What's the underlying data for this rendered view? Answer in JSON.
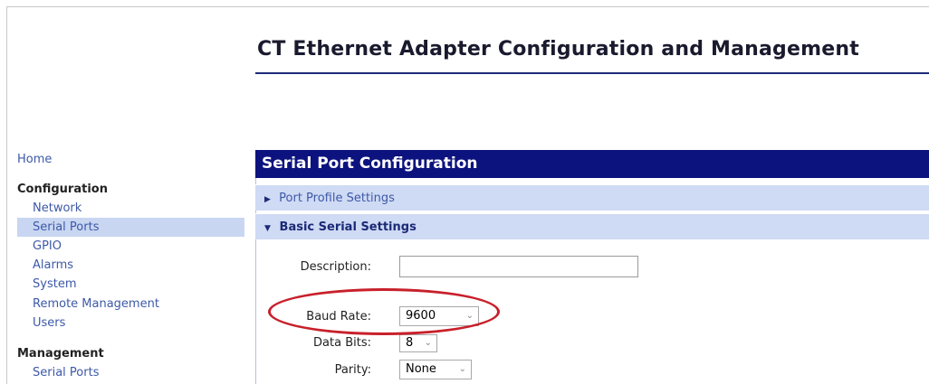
{
  "header": {
    "title": "CT Ethernet Adapter Configuration and Management"
  },
  "sidebar": {
    "home": "Home",
    "configuration": {
      "heading": "Configuration",
      "items": [
        "Network",
        "Serial Ports",
        "GPIO",
        "Alarms",
        "System",
        "Remote Management",
        "Users"
      ],
      "selected": "Serial Ports"
    },
    "management": {
      "heading": "Management",
      "items": [
        "Serial Ports"
      ]
    }
  },
  "main": {
    "panel_title": "Serial Port Configuration",
    "sections": [
      {
        "label": "Port Profile Settings",
        "expanded": false,
        "caret": "▶"
      },
      {
        "label": "Basic Serial Settings",
        "expanded": true,
        "caret": "▼"
      }
    ],
    "fields": {
      "description": {
        "label": "Description:",
        "value": ""
      },
      "baud_rate": {
        "label": "Baud Rate:",
        "value": "9600"
      },
      "data_bits": {
        "label": "Data Bits:",
        "value": "8"
      },
      "parity": {
        "label": "Parity:",
        "value": "None"
      }
    }
  },
  "colors": {
    "panel_header": "#0d137e",
    "section_bar": "#cfdaf4",
    "link": "#3d59a8",
    "highlight_circle": "#c8202b"
  },
  "icons": {
    "collapsed": "triangle-right-icon",
    "expanded": "triangle-down-icon",
    "dropdown": "chevron-down-icon"
  }
}
